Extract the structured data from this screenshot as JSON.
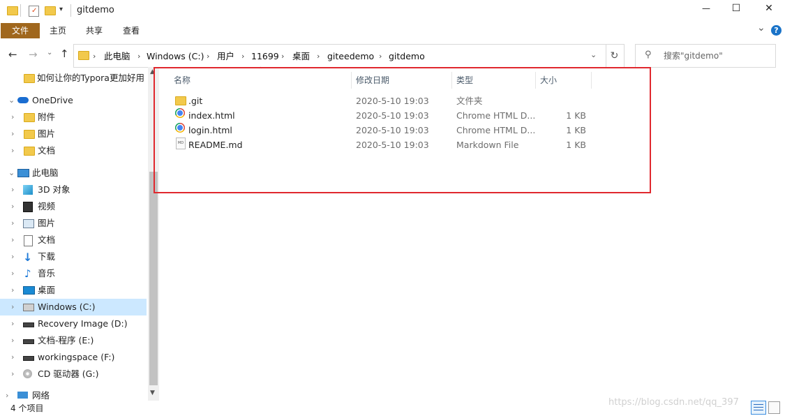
{
  "window": {
    "title": "gitdemo",
    "minimize": "—",
    "maximize": "☐",
    "close": "✕"
  },
  "ribbon": {
    "tabs": [
      "文件",
      "主页",
      "共享",
      "查看"
    ],
    "expand_glyph": "⌄",
    "help_glyph": "?"
  },
  "address": {
    "path": [
      "此电脑",
      "Windows (C:)",
      "用户",
      "11699",
      "桌面",
      "giteedemo",
      "gitdemo"
    ],
    "search_placeholder": "搜索\"gitdemo\""
  },
  "nav": {
    "pinned": "如何让你的Typora更加好用",
    "onedrive": "OneDrive",
    "onedrive_children": [
      "附件",
      "图片",
      "文档"
    ],
    "this_pc": "此电脑",
    "pc_children": [
      "3D 对象",
      "视频",
      "图片",
      "文档",
      "下载",
      "音乐",
      "桌面",
      "Windows (C:)",
      "Recovery Image (D:)",
      "文档-程序 (E:)",
      "workingspace (F:)",
      "CD 驱动器 (G:)"
    ],
    "network": "网络"
  },
  "columns": {
    "name": "名称",
    "modified": "修改日期",
    "type": "类型",
    "size": "大小"
  },
  "files": [
    {
      "name": ".git",
      "modified": "2020-5-10 19:03",
      "type": "文件夹",
      "size": "",
      "icon": "folder-icon"
    },
    {
      "name": "index.html",
      "modified": "2020-5-10 19:03",
      "type": "Chrome HTML D...",
      "size": "1 KB",
      "icon": "chrome-icon"
    },
    {
      "name": "login.html",
      "modified": "2020-5-10 19:03",
      "type": "Chrome HTML D...",
      "size": "1 KB",
      "icon": "chrome-icon"
    },
    {
      "name": "README.md",
      "modified": "2020-5-10 19:03",
      "type": "Markdown File",
      "size": "1 KB",
      "icon": "markdown-file-icon"
    }
  ],
  "status": {
    "count": "4 个项目"
  },
  "watermark": "https://blog.csdn.net/qq_397",
  "colors": {
    "file_tab": "#a0671d",
    "highlight_box": "#e0282e",
    "selected_nav": "#cce8ff"
  }
}
